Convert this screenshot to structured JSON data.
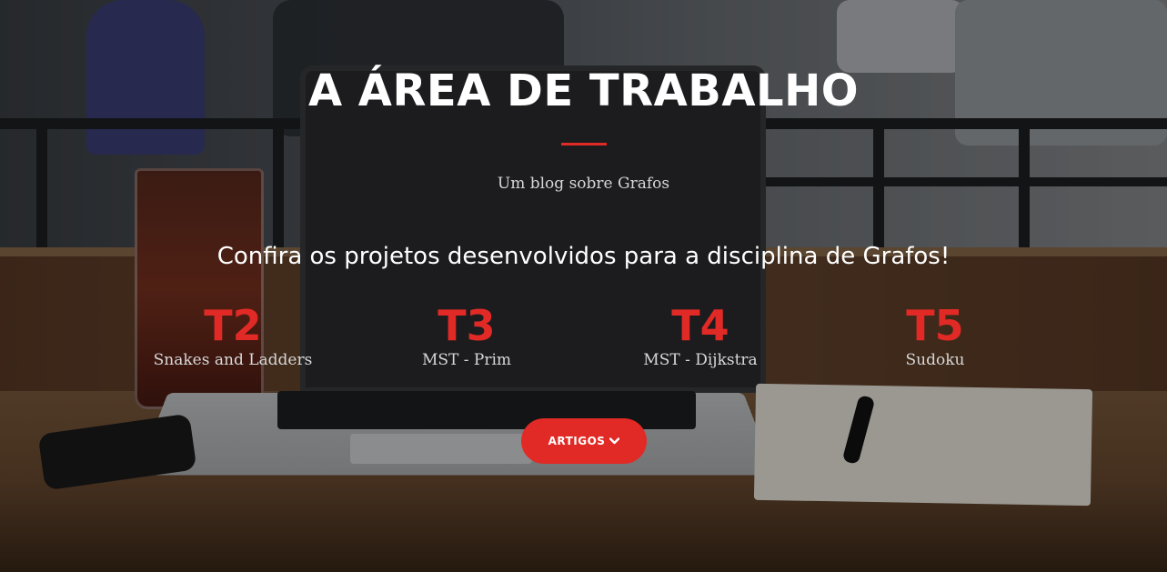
{
  "header": {
    "title": "A ÁREA DE TRABALHO",
    "subtitle": "Um blog sobre Grafos",
    "tagline": "Confira os projetos desenvolvidos para a disciplina de Grafos!"
  },
  "projects": [
    {
      "code": "T2",
      "name": "Snakes and Ladders"
    },
    {
      "code": "T3",
      "name": "MST - Prim"
    },
    {
      "code": "T4",
      "name": "MST - Dijkstra"
    },
    {
      "code": "T5",
      "name": "Sudoku"
    }
  ],
  "cta": {
    "label": "ARTIGOS",
    "icon": "chevron-down-icon"
  },
  "colors": {
    "accent": "#e12a26",
    "title": "#ffffff",
    "subtitle": "#d6d6d6"
  }
}
